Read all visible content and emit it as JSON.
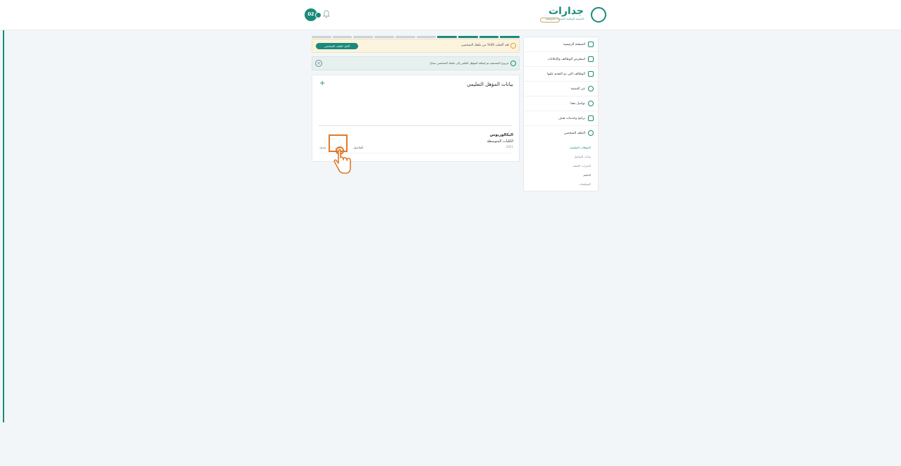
{
  "header": {
    "logo_text": "جدارات",
    "logo_sub": "المنصة الوطنية الموحدة للتوظيف",
    "avatar_initials": "DZ"
  },
  "sidebar": {
    "items": [
      {
        "label": "الصفحة الرئيسية",
        "icon": "home-icon"
      },
      {
        "label": "استعرض الوظائف والإعلانات",
        "icon": "briefcase-icon"
      },
      {
        "label": "الوظائف التي تم التقدم عليها",
        "icon": "send-icon"
      },
      {
        "label": "عن المنصة",
        "icon": "info-icon"
      },
      {
        "label": "تواصل معنا",
        "icon": "chat-icon"
      },
      {
        "label": "برامج وخدمات هدف",
        "icon": "grid-icon"
      },
      {
        "label": "الملف الشخصي",
        "icon": "user-icon"
      }
    ],
    "sub_items": [
      {
        "label": "المؤهلات التعليمية",
        "state": "active"
      },
      {
        "label": "بيانات التواصل",
        "state": "normal"
      },
      {
        "label": "الخبرات العملية",
        "state": "normal"
      },
      {
        "label": "التعليم",
        "state": "dark"
      },
      {
        "label": "التوظيفات",
        "state": "normal"
      }
    ]
  },
  "progress": {
    "segments": 10,
    "completed": 4
  },
  "warning": {
    "text": "لقد أكملت 40% من ملفك الشخصي",
    "button": "أكمل الملف الشخصي"
  },
  "success": {
    "text": "عزيزي المستفيد تم إضافة المؤهل العلمي إلى ملفك الشخصي بنجاح"
  },
  "qualifications": {
    "title": "بيانات المؤهل التعليمي",
    "entry": {
      "degree": "البكالوريوس",
      "institution": "الكليات المتوسطة",
      "year": "2021"
    },
    "actions": {
      "details": "التفاصيل",
      "delete": "حذف",
      "edit": "تعديل"
    }
  },
  "colors": {
    "brand": "#1b8a7a",
    "highlight": "#e07a2a",
    "warning_bg": "#fbf3dd"
  }
}
